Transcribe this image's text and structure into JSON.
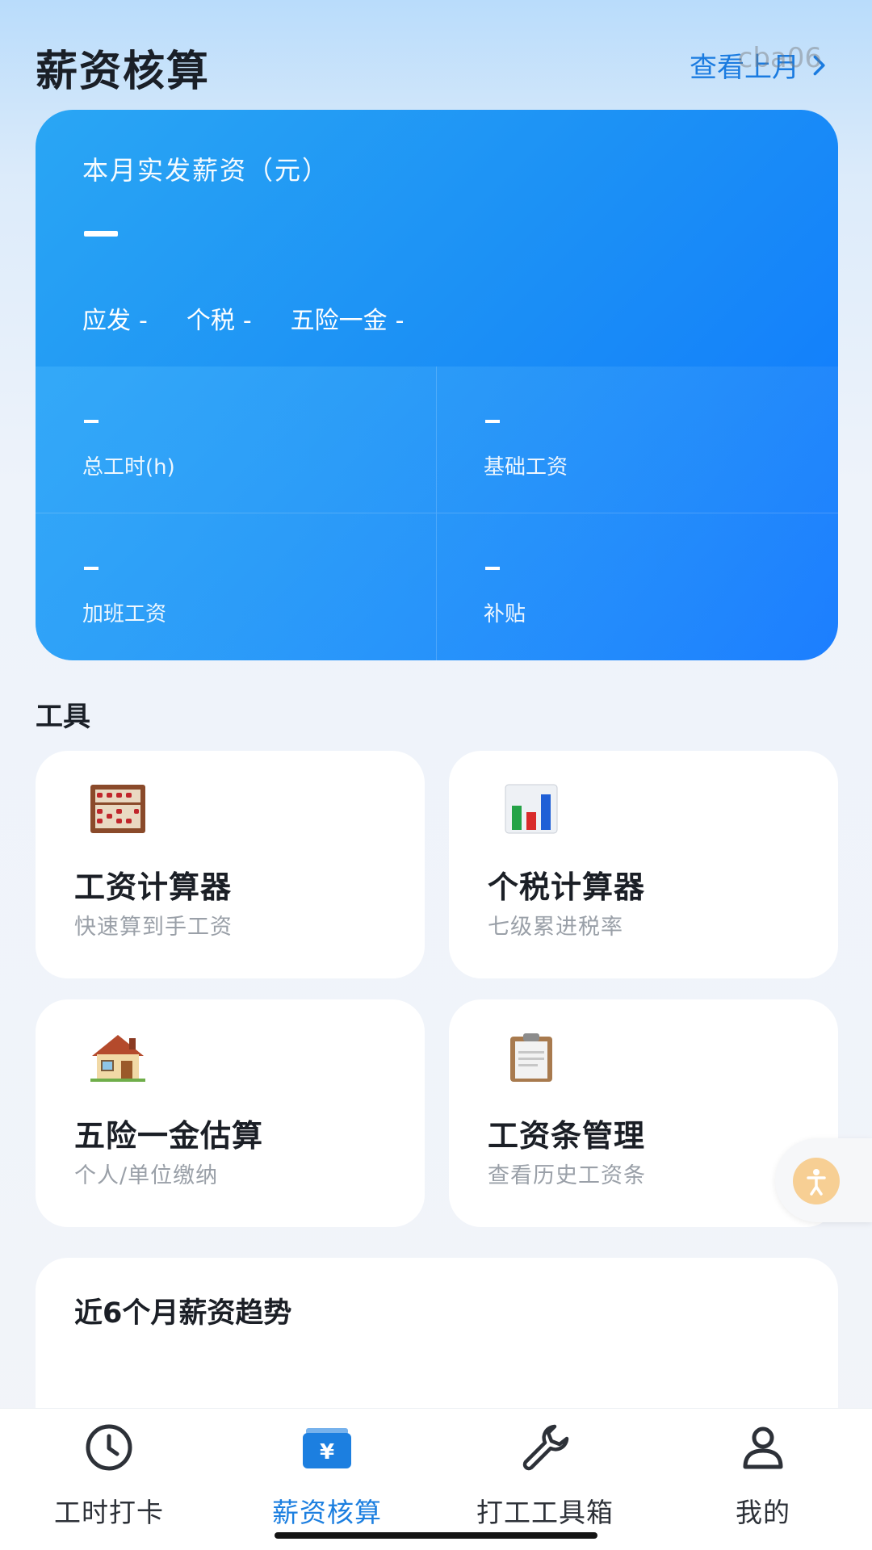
{
  "header": {
    "title": "薪资核算",
    "prev_month": "查看上月",
    "watermark": "cba06"
  },
  "salary_card": {
    "label": "本月实发薪资（元）",
    "amount": "—",
    "summary": [
      {
        "label": "应发",
        "value": "-"
      },
      {
        "label": "个税",
        "value": "-"
      },
      {
        "label": "五险一金",
        "value": "-"
      }
    ],
    "grid": [
      {
        "value": "—",
        "label": "总工时(h)"
      },
      {
        "value": "—",
        "label": "基础工资"
      },
      {
        "value": "—",
        "label": "加班工资"
      },
      {
        "value": "—",
        "label": "补贴"
      }
    ]
  },
  "tools": {
    "section_title": "工具",
    "items": [
      {
        "name": "工资计算器",
        "desc": "快速算到手工资",
        "icon": "abacus-icon"
      },
      {
        "name": "个税计算器",
        "desc": "七级累进税率",
        "icon": "bar-chart-icon"
      },
      {
        "name": "五险一金估算",
        "desc": "个人/单位缴纳",
        "icon": "house-icon"
      },
      {
        "name": "工资条管理",
        "desc": "查看历史工资条",
        "icon": "clipboard-icon"
      }
    ]
  },
  "trend": {
    "title": "近6个月薪资趋势"
  },
  "nav": {
    "items": [
      {
        "label": "工时打卡",
        "icon": "clock-icon",
        "active": false
      },
      {
        "label": "薪资核算",
        "icon": "wallet-yen-icon",
        "active": true
      },
      {
        "label": "打工工具箱",
        "icon": "wrench-icon",
        "active": false
      },
      {
        "label": "我的",
        "icon": "user-icon",
        "active": false
      }
    ]
  },
  "colors": {
    "accent": "#1c7fe0",
    "card_gradient_start": "#2aa6f4",
    "card_gradient_end": "#0e76ff"
  }
}
